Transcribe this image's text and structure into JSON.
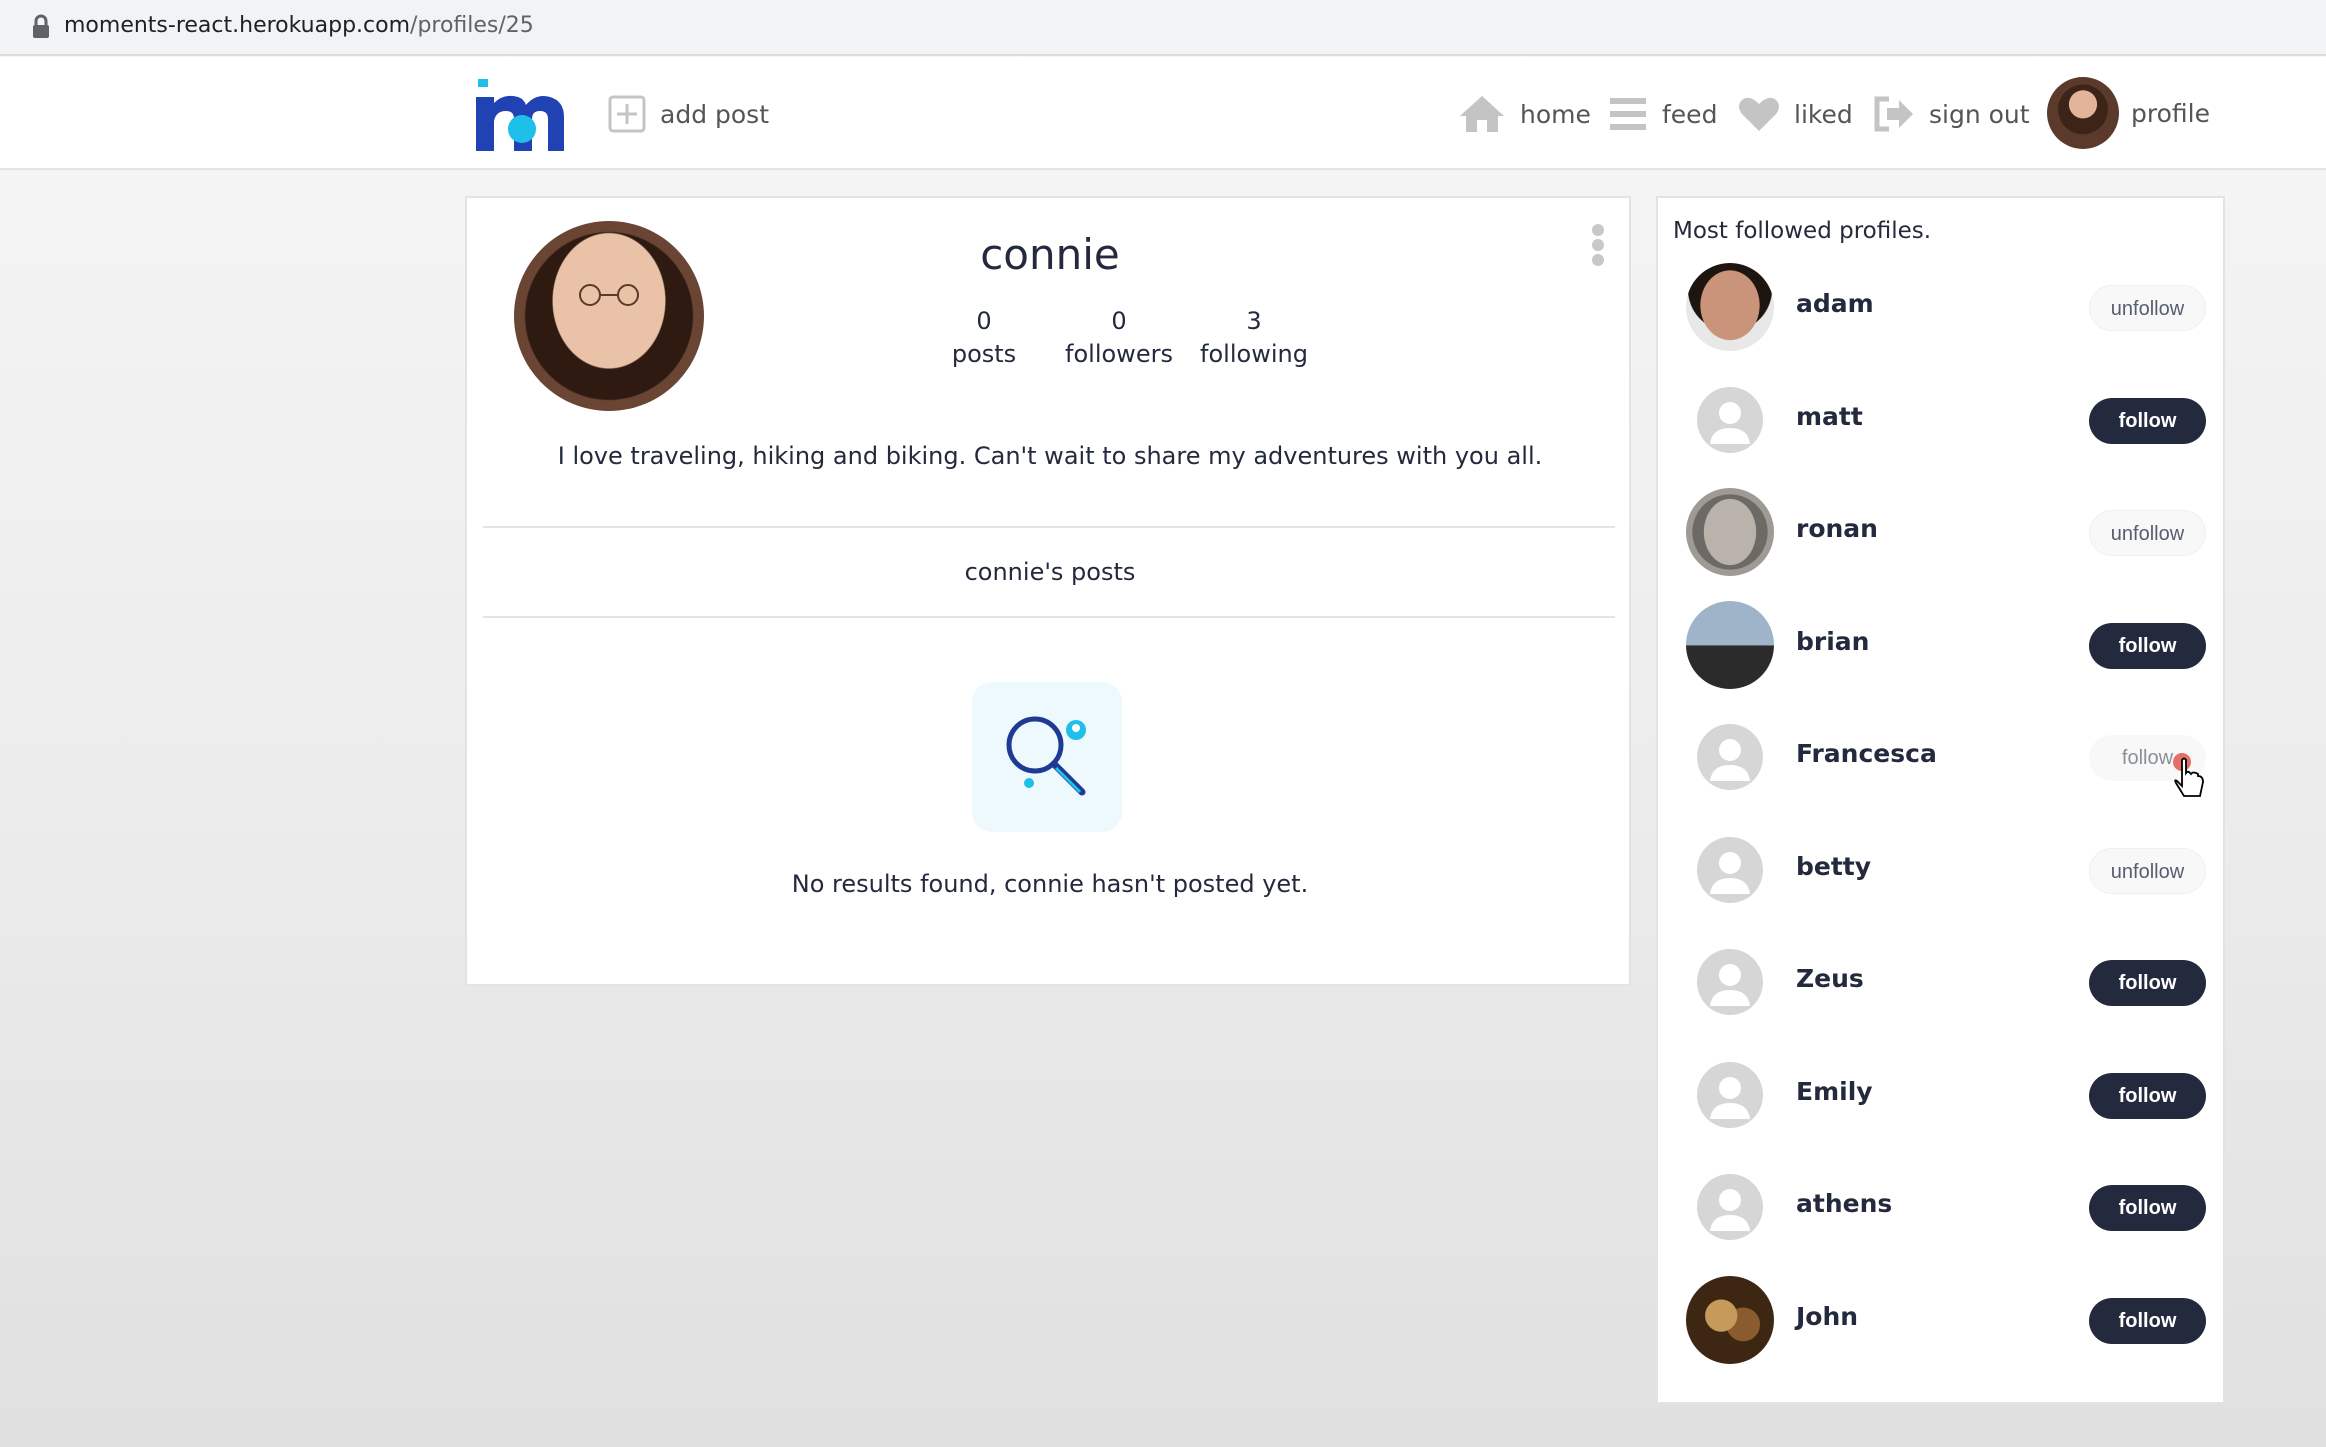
{
  "browser": {
    "url_domain": "moments-react.herokuapp.com",
    "url_path": "/profiles/25"
  },
  "navbar": {
    "logo_icon": "moments-logo-icon",
    "add_post": "add post",
    "home": "home",
    "feed": "feed",
    "liked": "liked",
    "sign_out": "sign out",
    "profile": "profile"
  },
  "profile": {
    "name": "connie",
    "stats": [
      {
        "value": "0",
        "label": "posts"
      },
      {
        "value": "0",
        "label": "followers"
      },
      {
        "value": "3",
        "label": "following"
      }
    ],
    "bio": "I love traveling, hiking and biking. Can't wait to share my adventures with you all.",
    "posts_heading": "connie's posts",
    "no_results": "No results found, connie hasn't posted yet."
  },
  "sidebar": {
    "title": "Most followed profiles.",
    "profiles": [
      {
        "name": "adam",
        "action": "unfollow",
        "avatar": "photo"
      },
      {
        "name": "matt",
        "action": "follow",
        "avatar": "default"
      },
      {
        "name": "ronan",
        "action": "unfollow",
        "avatar": "photo"
      },
      {
        "name": "brian",
        "action": "follow",
        "avatar": "photo"
      },
      {
        "name": "Francesca",
        "action": "follow",
        "avatar": "default"
      },
      {
        "name": "betty",
        "action": "unfollow",
        "avatar": "default"
      },
      {
        "name": "Zeus",
        "action": "follow",
        "avatar": "default"
      },
      {
        "name": "Emily",
        "action": "follow",
        "avatar": "default"
      },
      {
        "name": "athens",
        "action": "follow",
        "avatar": "default"
      },
      {
        "name": "John",
        "action": "follow",
        "avatar": "photo"
      }
    ]
  },
  "colors": {
    "brand_blue": "#2142b2",
    "brand_cyan": "#1ebfe8",
    "dark_button": "#242a3d",
    "text": "#242a3d"
  }
}
